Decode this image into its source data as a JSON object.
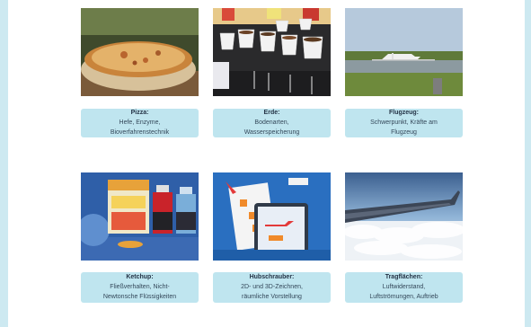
{
  "rows": [
    {
      "cards": [
        {
          "title": "Pizza:",
          "lines": [
            "Hefe, Enzyme,",
            "Bioverfahrenstechnik"
          ]
        },
        {
          "title": "Erde:",
          "lines": [
            "Bodenarten,",
            "Wasserspeicherung"
          ]
        },
        {
          "title": "Flugzeug:",
          "lines": [
            "Schwerpunkt, Kräfte am",
            "Flugzeug"
          ]
        }
      ]
    },
    {
      "cards": [
        {
          "title": "Ketchup:",
          "lines": [
            "Fließverhalten, Nicht-",
            "Newtonsche Flüssigkeiten"
          ]
        },
        {
          "title": "Hubschrauber:",
          "lines": [
            "2D- und 3D-Zeichnen,",
            "räumliche Vorstellung"
          ]
        },
        {
          "title": "Tragflächen:",
          "lines": [
            "Luftwiderstand,",
            "Luftströmungen, Auftrieb"
          ]
        }
      ]
    }
  ],
  "colors": {
    "card_bg": "#bfe5ef",
    "frame": "#cde9f1",
    "title_text": "#243346"
  },
  "icons": [
    "pizza-photo",
    "soil-cups-photo",
    "airplane-runway-photo",
    "ketchup-bottles-photo",
    "helicopter-tablet-photo",
    "wing-clouds-photo"
  ]
}
